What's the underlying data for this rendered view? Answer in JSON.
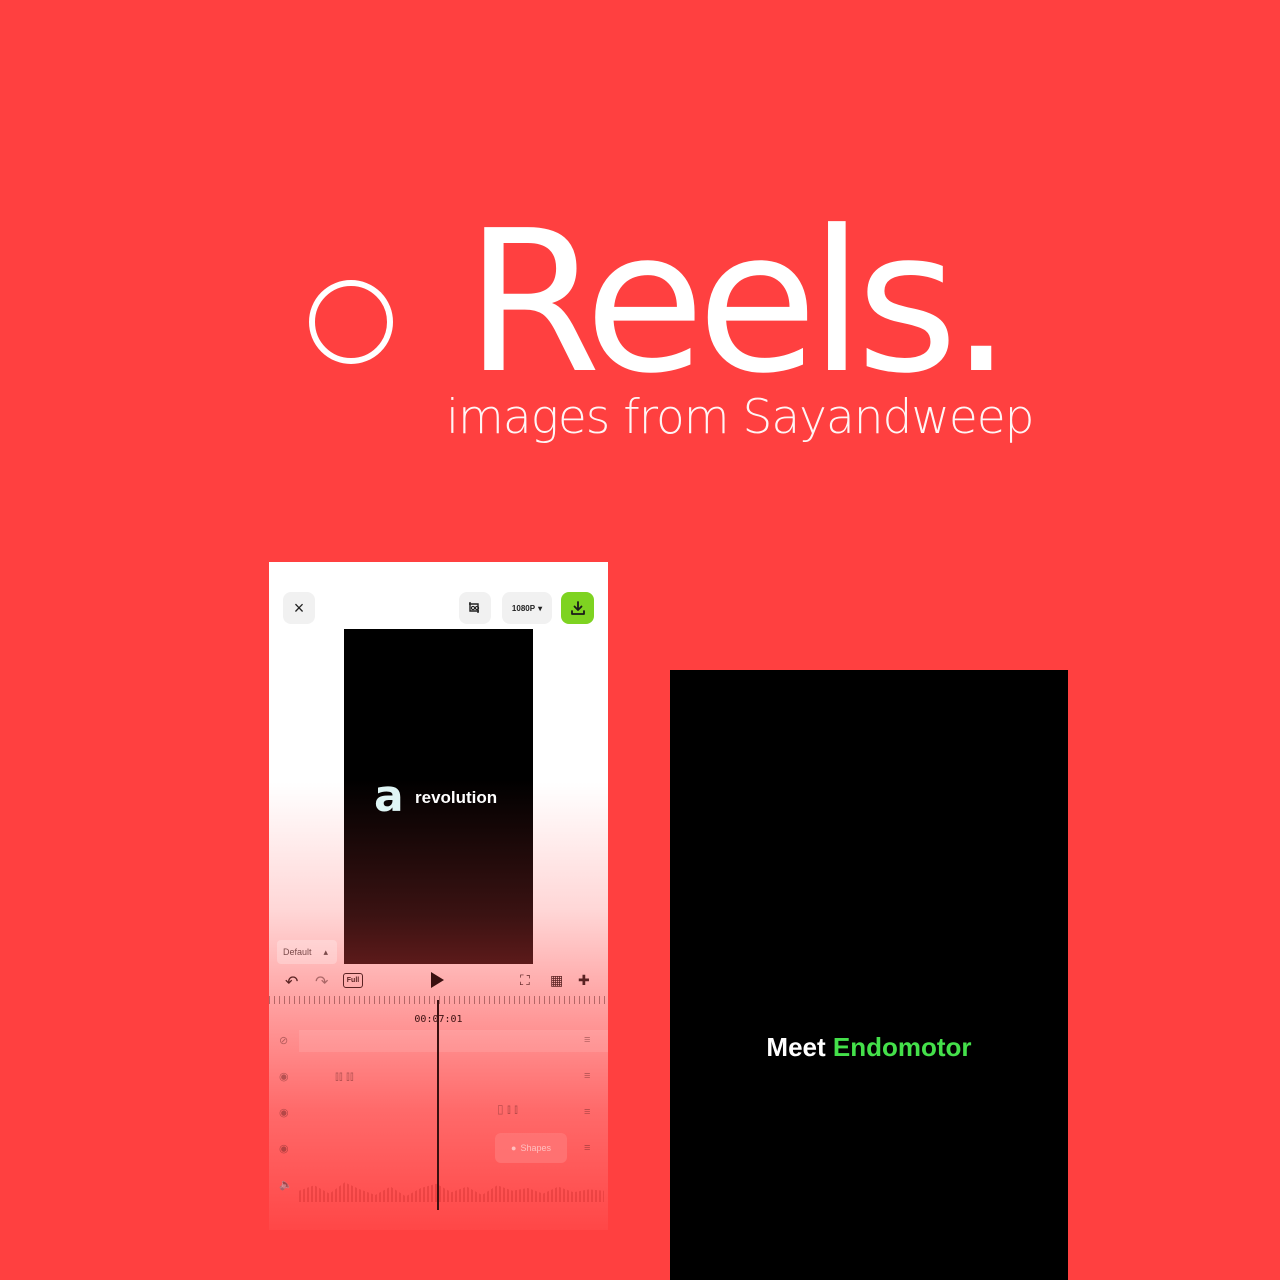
{
  "hero": {
    "title": "Reels.",
    "subtitle": "images from Sayandweep"
  },
  "editor": {
    "close_icon": "×",
    "resolution_label": "1080P",
    "resolution_caret": "▾",
    "preview_logo": "a",
    "preview_text": "revolution",
    "default_label": "Default",
    "default_caret": "▴",
    "full_label": "Full",
    "timecode": "00:07:01",
    "shapes_label": "Shapes"
  },
  "reel2": {
    "prefix": "Meet",
    "brand": "Endomotor"
  },
  "colors": {
    "background": "#ff4040",
    "export_button": "#7ed321",
    "brand_green": "#44e04a"
  }
}
